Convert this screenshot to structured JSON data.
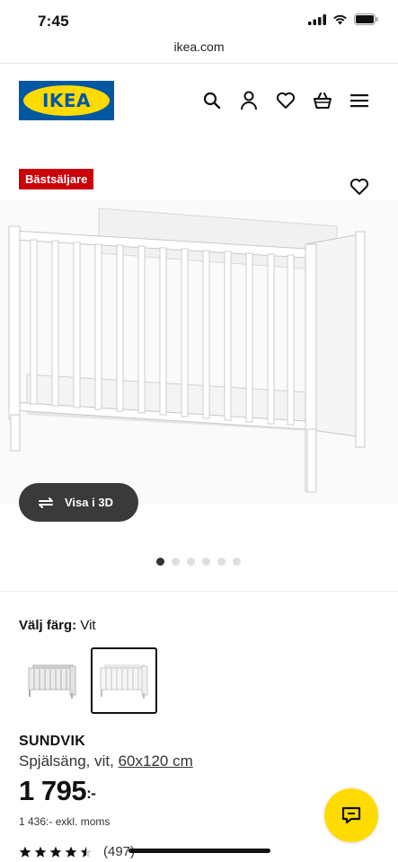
{
  "status_bar": {
    "time": "7:45"
  },
  "browser": {
    "url": "ikea.com"
  },
  "header": {
    "logo_text": "IKEA",
    "icons": [
      "search-icon",
      "user-icon",
      "heart-icon",
      "basket-icon",
      "menu-icon"
    ]
  },
  "product_media": {
    "badge": "Bästsäljare",
    "view_3d_label": "Visa i 3D",
    "image_count": 6,
    "active_image": 1
  },
  "color_picker": {
    "label": "Välj färg:",
    "value": "Vit"
  },
  "product": {
    "name": "SUNDVIK",
    "description": "Spjälsäng, vit,",
    "size": "60x120 cm",
    "price": "1 795",
    "price_suffix": ":-",
    "price_excl": "1 436:- exkl. moms",
    "rating": 4.5,
    "review_count": "(497)"
  },
  "colors": {
    "brand_blue": "#0058a3",
    "brand_yellow": "#ffdb00",
    "badge_red": "#cc0008"
  }
}
